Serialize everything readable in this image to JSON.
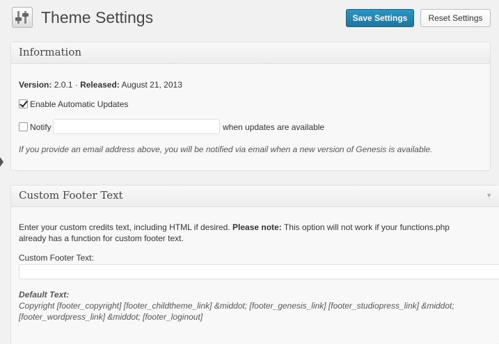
{
  "header": {
    "title": "Theme Settings",
    "save_label": "Save Settings",
    "reset_label": "Reset Settings"
  },
  "information": {
    "title": "Information",
    "version_label": "Version:",
    "version_value": "2.0.1",
    "separator": "·",
    "released_label": "Released:",
    "released_value": "August 21, 2013",
    "auto_updates_label": "Enable Automatic Updates",
    "auto_updates_checked": true,
    "notify_label": "Notify",
    "notify_checked": false,
    "notify_email_value": "",
    "notify_suffix": "when updates are available",
    "notify_hint": "If you provide an email address above, you will be notified via email when a new version of Genesis is available."
  },
  "custom_footer": {
    "title": "Custom Footer Text",
    "toggle_icon": "triangle-down-icon",
    "description_intro": "Enter your custom credits text, including HTML if desired.",
    "description_note_label": "Please note:",
    "description_note_line1": "This option will not work if your functions.php",
    "description_note_line2": "already has a function for custom footer text.",
    "field_label": "Custom Footer Text:",
    "field_value": "",
    "default_label": "Default Text:",
    "default_line1": "Copyright [footer_copyright] [footer_childtheme_link] &middot; [footer_genesis_link] [footer_studiopress_link] &middot;",
    "default_line2": "[footer_wordpress_link] &middot; [footer_loginout]"
  },
  "colors": {
    "primary_button": "#21759b",
    "background": "#f1f1f1"
  }
}
